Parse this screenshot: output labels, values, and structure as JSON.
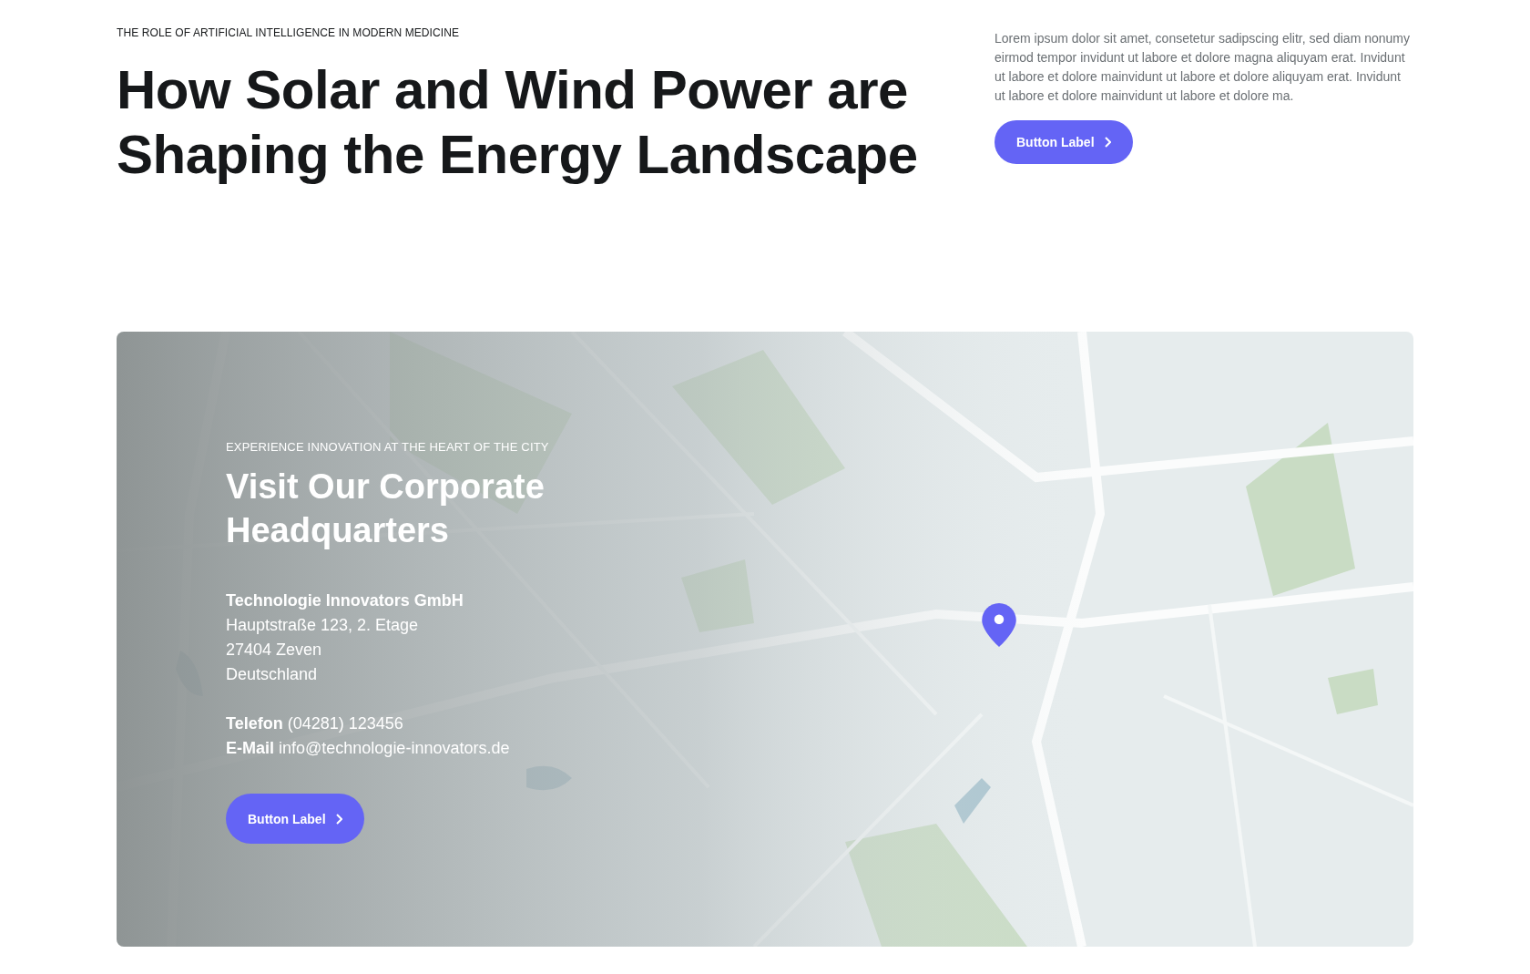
{
  "article": {
    "eyebrow": "THE ROLE OF ARTIFICIAL INTELLIGENCE IN MODERN MEDICINE",
    "title": "How Solar and Wind Power are Shaping the Energy Landscape",
    "intro": "Lorem ipsum dolor sit amet, consetetur sadipscing elitr, sed diam nonumy eirmod tempor invidunt ut labore et dolore magna aliquyam erat. Invidunt ut labore et dolore mainvidunt ut labore et dolore aliquyam erat. Invidunt ut labore et dolore mainvidunt ut labore et dolore ma.",
    "button": {
      "label": "Button Label"
    }
  },
  "location": {
    "eyebrow": "EXPERIENCE INNOVATION AT THE HEART OF THE CITY",
    "title": "Visit Our Corporate Headquarters",
    "company": "Technologie Innovators GmbH",
    "address": [
      "Hauptstraße 123, 2. Etage",
      "27404 Zeven",
      "Deutschland"
    ],
    "contacts": [
      "**Telefon** (04281) 123456",
      "**E-Mail** info@technologie-innovators.de"
    ],
    "button": {
      "label": "Button Label"
    }
  }
}
